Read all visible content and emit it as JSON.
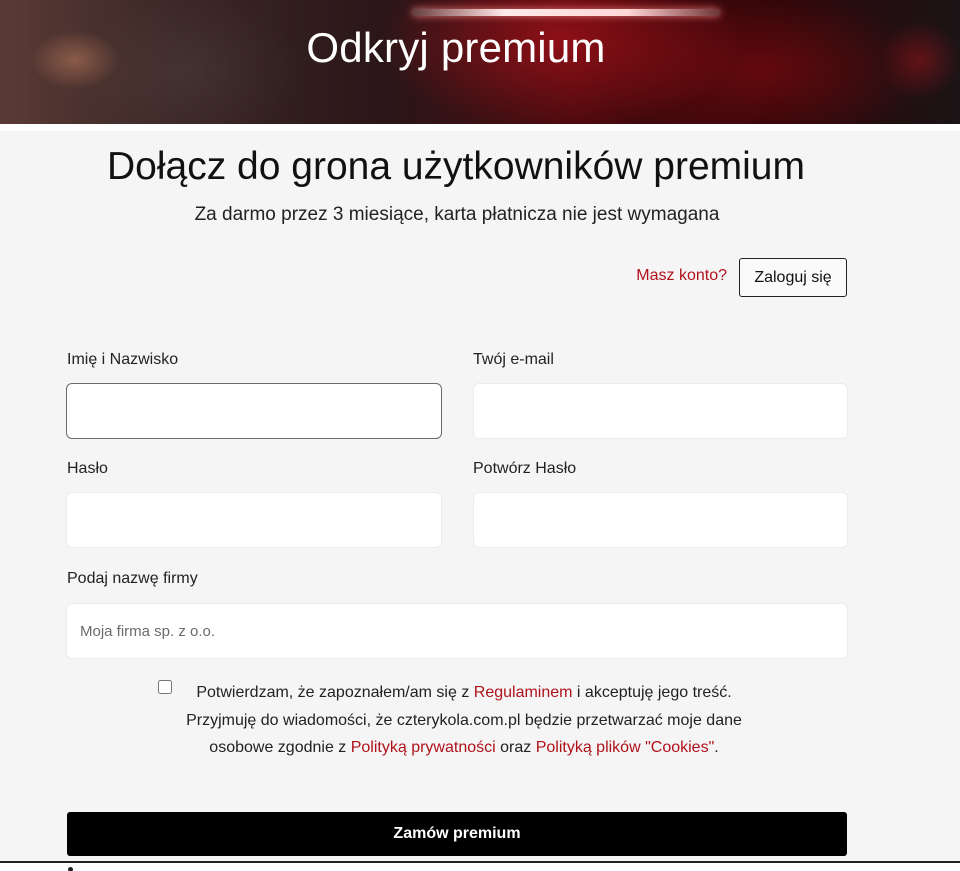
{
  "hero": {
    "title": "Odkryj premium"
  },
  "signup": {
    "title": "Dołącz do grona użytkowników premium",
    "subtitle": "Za darmo przez 3 miesiące, karta płatnicza nie jest wymagana",
    "have_account": "Masz konto?",
    "login_label": "Zaloguj się"
  },
  "form": {
    "name_label": "Imię i Nazwisko",
    "name_value": "",
    "email_label": "Twój e-mail",
    "email_value": "",
    "password_label": "Hasło",
    "password_value": "",
    "confirm_label": "Potwórz Hasło",
    "confirm_value": "",
    "company_label": "Podaj nazwę firmy",
    "company_placeholder": "Moja firma sp. z o.o.",
    "company_value": ""
  },
  "consent": {
    "checked": false,
    "text_1": "Potwierdzam, że zapoznałem/am się z ",
    "link_terms": "Regulaminem",
    "text_2": " i akceptuję jego treść. Przyjmuję do wiadomości, że czterykola.com.pl będzie przetwarzać moje dane osobowe zgodnie z ",
    "link_privacy": "Polityką prywatności",
    "text_3": " oraz ",
    "link_cookies": "Polityką plików \"Cookies\"",
    "text_4": "."
  },
  "submit_label": "Zamów premium",
  "colors": {
    "accent_red": "#b0121b",
    "submit_bg": "#000000",
    "page_bg": "#f5f5f5"
  }
}
